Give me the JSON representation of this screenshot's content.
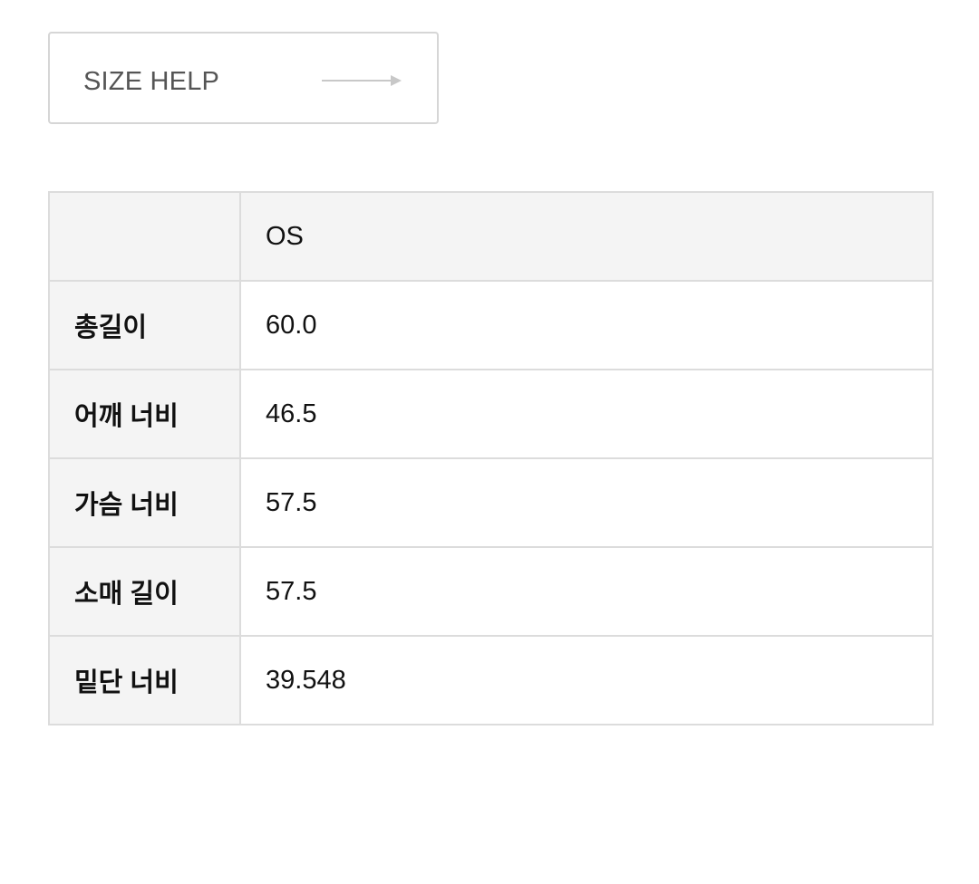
{
  "size_help": {
    "label": "SIZE HELP",
    "arrow_icon": "arrow-right-icon"
  },
  "size_table": {
    "header": {
      "corner": "",
      "size": "OS"
    },
    "rows": [
      {
        "label": "총길이",
        "value": "60.0"
      },
      {
        "label": "어깨 너비",
        "value": "46.5"
      },
      {
        "label": "가슴 너비",
        "value": "57.5"
      },
      {
        "label": "소매 길이",
        "value": "57.5"
      },
      {
        "label": "밑단 너비",
        "value": "39.548"
      }
    ]
  }
}
